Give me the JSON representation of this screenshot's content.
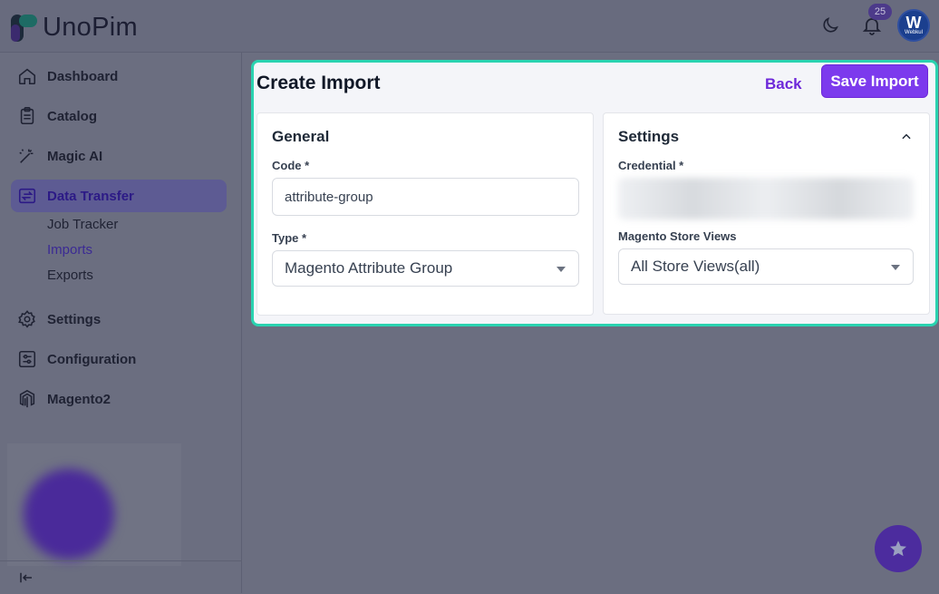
{
  "app": {
    "logo_text": "UnoPim"
  },
  "header": {
    "notification_count": "25",
    "avatar_initial": "W",
    "avatar_subtext": "Webkul"
  },
  "sidebar": {
    "items": [
      {
        "label": "Dashboard",
        "icon": "home-icon"
      },
      {
        "label": "Catalog",
        "icon": "clipboard-icon"
      },
      {
        "label": "Magic AI",
        "icon": "magic-wand-icon"
      },
      {
        "label": "Data Transfer",
        "icon": "transfer-icon",
        "active": true
      },
      {
        "label": "Settings",
        "icon": "gear-icon"
      },
      {
        "label": "Configuration",
        "icon": "sliders-icon"
      },
      {
        "label": "Magento2",
        "icon": "magento-icon"
      }
    ],
    "sub_items": [
      {
        "label": "Job Tracker"
      },
      {
        "label": "Imports",
        "active": true
      },
      {
        "label": "Exports"
      }
    ]
  },
  "page": {
    "title": "Create Import",
    "back_label": "Back",
    "save_label": "Save Import"
  },
  "general": {
    "title": "General",
    "code_label": "Code *",
    "code_value": "attribute-group",
    "type_label": "Type *",
    "type_value": "Magento Attribute Group"
  },
  "settings": {
    "title": "Settings",
    "credential_label": "Credential *",
    "store_views_label": "Magento Store Views",
    "store_views_value": "All Store Views(all)"
  },
  "colors": {
    "accent": "#7c3aed",
    "highlight_border": "#2ad3b0",
    "overlay": "#6b6e80"
  }
}
